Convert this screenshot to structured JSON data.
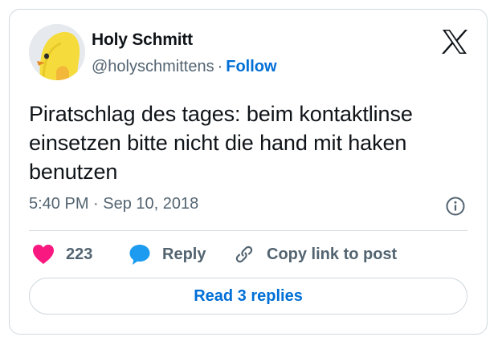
{
  "author": {
    "display_name": "Holy Schmitt",
    "handle": "@holyschmittens",
    "separator": "·",
    "follow_label": "Follow"
  },
  "tweet": {
    "text": "Piratschlag des tages: beim kontaktlinse einsetzen bitte nicht die hand mit haken benutzen",
    "timestamp": "5:40 PM · Sep 10, 2018"
  },
  "actions": {
    "like_count": "223",
    "reply_label": "Reply",
    "copy_link_label": "Copy link to post"
  },
  "read_replies_label": "Read 3 replies",
  "icons": {
    "avatar": "yellow-chick-avatar",
    "brand": "x-logo-icon",
    "info": "info-icon",
    "like": "heart-icon",
    "reply": "speech-bubble-icon",
    "copy": "link-icon"
  },
  "colors": {
    "accent_blue": "#006fd6",
    "like_pink": "#f91880",
    "reply_blue": "#1d9bf0",
    "text": "#0f1419",
    "secondary_text": "#536471",
    "border": "#cfd9de"
  }
}
